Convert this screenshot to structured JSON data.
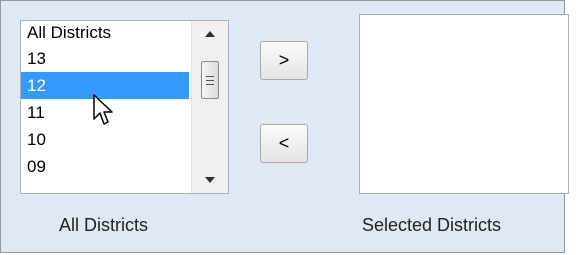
{
  "all_districts": {
    "items": [
      "All Districts",
      "13",
      "12",
      "11",
      "10",
      "09"
    ],
    "selected_index": 2,
    "caption": "All Districts"
  },
  "buttons": {
    "add_label": ">",
    "remove_label": "<"
  },
  "selected_districts": {
    "items": [],
    "caption": "Selected Districts"
  },
  "colors": {
    "panel_background": "#dfe8f4",
    "selection_highlight": "#3399ff"
  },
  "icons": {
    "scroll_up": "triangle-up-icon",
    "scroll_down": "triangle-down-icon",
    "cursor": "mouse-pointer-icon"
  }
}
